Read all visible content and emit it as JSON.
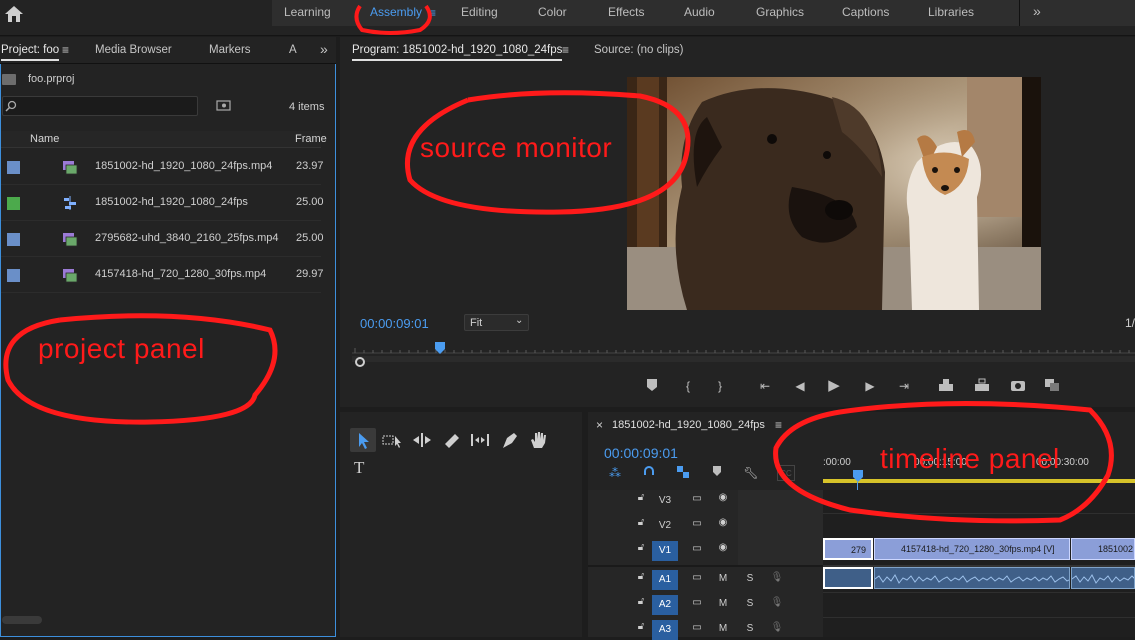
{
  "workspaces": {
    "items": [
      "Learning",
      "Assembly",
      "Editing",
      "Color",
      "Effects",
      "Audio",
      "Graphics",
      "Captions",
      "Libraries"
    ],
    "active": "Assembly",
    "more": "»"
  },
  "project": {
    "tabs": [
      "Project: foo",
      "Media Browser",
      "Markers",
      "A"
    ],
    "tab_more": "»",
    "file": "foo.prproj",
    "item_count": "4 items",
    "col_name": "Name",
    "col_frame": "Frame",
    "rows": [
      {
        "name": "1851002-hd_1920_1080_24fps.mp4",
        "rate": "23.97",
        "color": "#6a8fc8",
        "kind": "clip"
      },
      {
        "name": "1851002-hd_1920_1080_24fps",
        "rate": "25.00",
        "color": "#4caa4c",
        "kind": "sequence"
      },
      {
        "name": "2795682-uhd_3840_2160_25fps.mp4",
        "rate": "25.00",
        "color": "#6a8fc8",
        "kind": "clip"
      },
      {
        "name": "4157418-hd_720_1280_30fps.mp4",
        "rate": "29.97",
        "color": "#6a8fc8",
        "kind": "clip"
      }
    ]
  },
  "program": {
    "tab_active": "Program: 1851002-hd_1920_1080_24fps",
    "tab_source": "Source: (no clips)",
    "timecode": "00:00:09:01",
    "zoom": "Fit",
    "right_fraction": "1/"
  },
  "timeline": {
    "close": "×",
    "sequence_name": "1851002-hd_1920_1080_24fps",
    "timecode": "00:00:09:01",
    "ruler_start": ":00:00",
    "ruler_mid": "00:00:15:00",
    "ruler_end": "00:00:30:00",
    "video_tracks": [
      "V3",
      "V2",
      "V1"
    ],
    "audio_tracks": [
      "A1",
      "A2",
      "A3"
    ],
    "mute": "M",
    "solo": "S",
    "clips": {
      "v1_a": "279",
      "v1_b": "4157418-hd_720_1280_30fps.mp4 [V]",
      "v1_c": "1851002"
    }
  },
  "annotations": {
    "source": "source monitor",
    "project": "project panel",
    "timeline": "timeline panel"
  },
  "colors": {
    "accent": "#4b9cf0",
    "annotation": "#ff1a1a",
    "clip_video": "#8b9ed8",
    "clip_audio": "#3f5f88"
  },
  "icons": [
    "home-icon",
    "search-icon",
    "new-bin-icon",
    "clip-icon",
    "sequence-icon",
    "marker-icon",
    "in-point-icon",
    "out-point-icon",
    "go-to-in-icon",
    "step-back-icon",
    "play-icon",
    "step-forward-icon",
    "go-to-out-icon",
    "lift-icon",
    "extract-icon",
    "export-frame-icon",
    "comparison-icon",
    "selection-tool-icon",
    "track-select-tool-icon",
    "ripple-edit-tool-icon",
    "razor-tool-icon",
    "slip-tool-icon",
    "pen-tool-icon",
    "hand-tool-icon",
    "type-tool-icon",
    "lock-icon",
    "toggle-sync-icon",
    "eye-icon",
    "mic-icon",
    "wrench-icon",
    "playhead-icon"
  ]
}
